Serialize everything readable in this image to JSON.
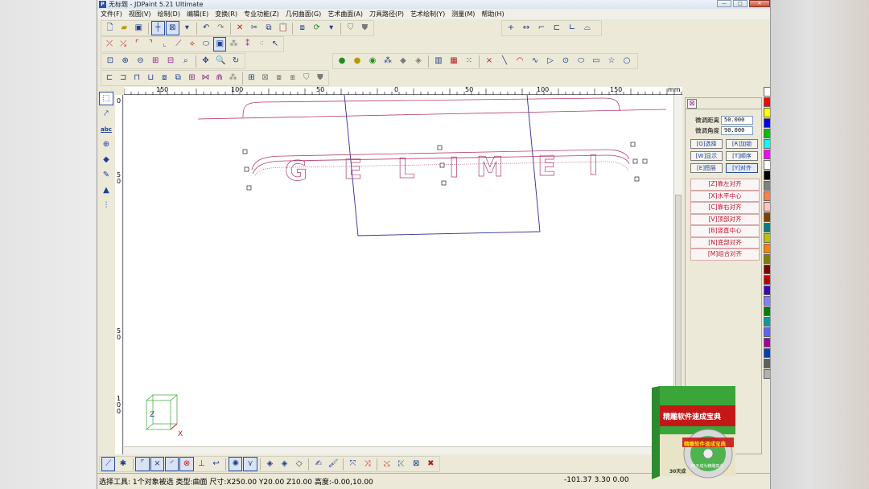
{
  "window": {
    "title": "无标题 - JDPaint 5.21 Ultimate",
    "app_icon": "P",
    "min": "—",
    "max": "□",
    "close": "✕"
  },
  "menu": [
    "文件(F)",
    "视图(V)",
    "绘制(D)",
    "编辑(E)",
    "变换(R)",
    "专业功能(Z)",
    "几何曲面(G)",
    "艺术曲面(A)",
    "刀具路径(P)",
    "艺术绘制(Y)",
    "测量(M)",
    "帮助(H)"
  ],
  "ruler": {
    "unit": "mm",
    "h_labels": [
      "150",
      "100",
      "50",
      "0",
      "50",
      "100",
      "150"
    ],
    "v_labels": [
      "0",
      "5\n0",
      "5\n0",
      "1\n0\n0"
    ]
  },
  "canvas": {
    "letters": [
      "G",
      "E",
      "L",
      "I",
      "M",
      "E",
      "I"
    ],
    "axis_z": "Z",
    "axis_x": "X"
  },
  "panel": {
    "dist_label": "微调距离",
    "dist_value": "50.000",
    "angle_label": "微调角度",
    "angle_value": "90.000",
    "buttons": [
      "[Q]选择",
      "[R]加锁",
      "[W]显示",
      "[T]顺序",
      "[E]图层",
      "[Y]对齐"
    ],
    "align_items": [
      "[Z]靠左对齐",
      "[X]水平中心",
      "[C]靠右对齐",
      "[V]顶部对齐",
      "[B]竖直中心",
      "[N]底部对齐",
      "[M]组合对齐"
    ]
  },
  "status": {
    "left": "选择工具: 1个对象被选 类型:曲面 尺寸:X250.00 Y20.00 Z10.00 高度:-0.00,10.00",
    "right": "-101.37 3.30 0.00"
  },
  "promo": {
    "box_title": "精雕软件速成宝典",
    "disc_title": "精雕软件速成宝典",
    "disc_sub": "30天成为精雕高手",
    "box_bottom": "30天成"
  },
  "colors": {
    "outline": "#b33b6e",
    "frame": "#2d2e8c",
    "accent": "#2a4f9c",
    "align_text": "#c0142a"
  },
  "palette": [
    "#ffffff",
    "#ff0000",
    "#ffff00",
    "#0000ff",
    "#00c000",
    "#00ffff",
    "#ff00ff",
    "#ffffff",
    "#000000",
    "#808080",
    "#ff8040",
    "#ffc0c0",
    "#804000",
    "#008080",
    "#c0c000",
    "#ff8000",
    "#808000",
    "#800000",
    "#c00000",
    "#4000c0",
    "#8080ff",
    "#008000",
    "#00a0a0",
    "#6060ff",
    "#a000a0",
    "#0040c0",
    "#606060",
    "#b0b0b0"
  ]
}
